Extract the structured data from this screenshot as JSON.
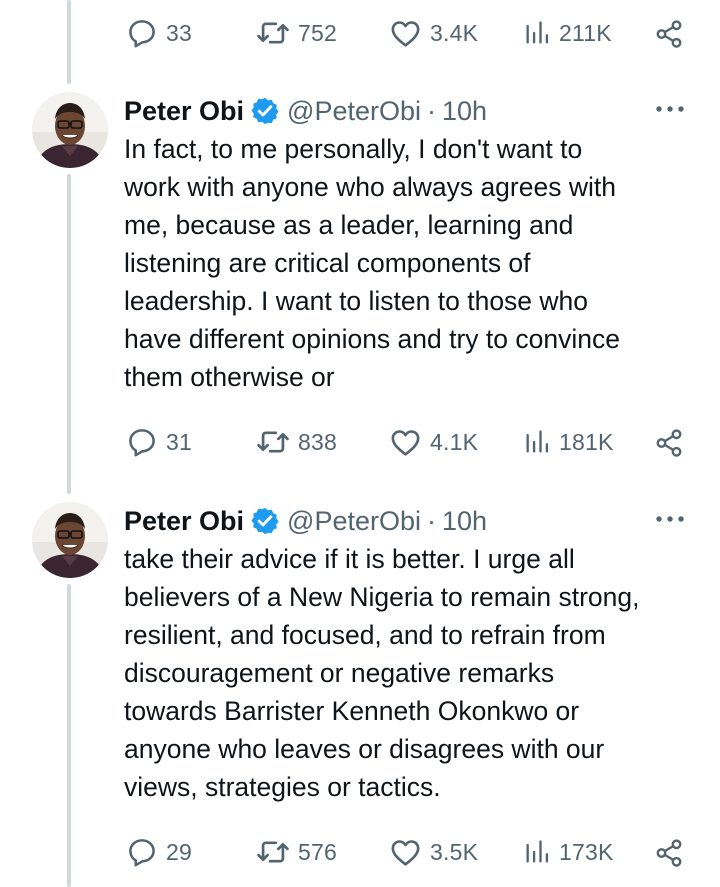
{
  "colors": {
    "text_primary": "#0f1419",
    "text_secondary": "#536471",
    "verified_blue": "#1d9bf0",
    "thread_line": "#cfd9de"
  },
  "top_actions": {
    "replies": "33",
    "reposts": "752",
    "likes": "3.4K",
    "views": "211K"
  },
  "tweets": [
    {
      "author_name": "Peter Obi",
      "handle": "@PeterObi",
      "separator": "·",
      "time": "10h",
      "verified": true,
      "lines": [
        "In fact, to me personally, I don't want to",
        "work with anyone who always agrees with",
        "me, because as a leader, learning and",
        "listening are critical components of",
        "leadership. I want to listen to those who",
        "have different opinions and try to convince",
        "them otherwise or"
      ],
      "replies": "31",
      "reposts": "838",
      "likes": "4.1K",
      "views": "181K"
    },
    {
      "author_name": "Peter Obi",
      "handle": "@PeterObi",
      "separator": "·",
      "time": "10h",
      "verified": true,
      "lines": [
        "take their advice if it is better. I urge all",
        "believers of a New Nigeria to remain strong,",
        "resilient, and focused, and to refrain from",
        "discouragement or negative remarks",
        "towards Barrister Kenneth Okonkwo or",
        "anyone who leaves or disagrees with our",
        "views, strategies or tactics."
      ],
      "replies": "29",
      "reposts": "576",
      "likes": "3.5K",
      "views": "173K"
    }
  ],
  "icons": {
    "reply": "reply-bubble-icon",
    "repost": "repost-arrows-icon",
    "like": "heart-icon",
    "views": "analytics-bars-icon",
    "share": "share-icon",
    "more": "more-dots-icon",
    "verified": "verified-badge-icon"
  }
}
